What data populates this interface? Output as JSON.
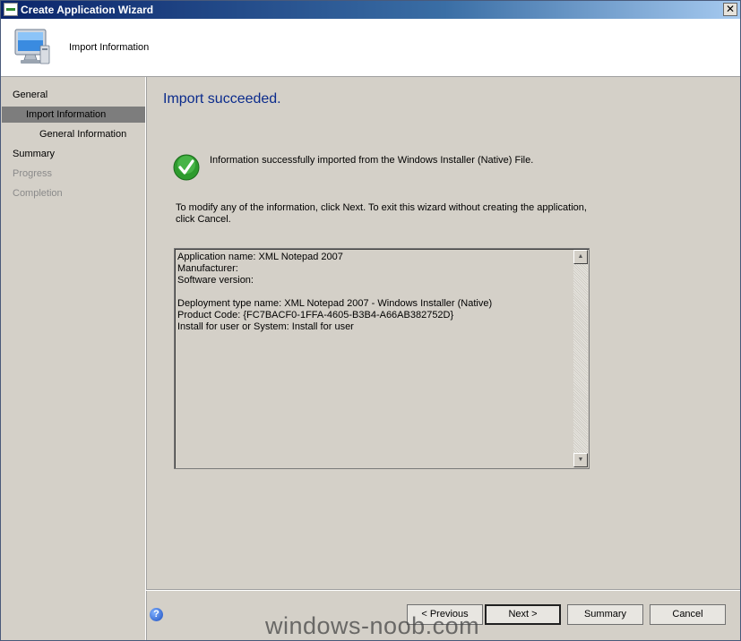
{
  "window": {
    "title": "Create Application Wizard",
    "close_glyph": "✕"
  },
  "header": {
    "title": "Import Information",
    "icon": "computer-monitor-icon"
  },
  "sidebar": {
    "items": [
      {
        "label": "General",
        "state": "normal"
      },
      {
        "label": "Import Information",
        "state": "selected"
      },
      {
        "label": "General Information",
        "state": "normal"
      },
      {
        "label": "Summary",
        "state": "normal"
      },
      {
        "label": "Progress",
        "state": "disabled"
      },
      {
        "label": "Completion",
        "state": "disabled"
      }
    ]
  },
  "content": {
    "title": "Import succeeded.",
    "success_icon": "green-checkmark-icon",
    "message": "Information successfully imported from the Windows Installer (Native) File.",
    "instruction": "To modify any of the information, click Next. To exit this wizard without creating the application, click Cancel.",
    "info_lines": [
      "Application name: XML Notepad 2007",
      "Manufacturer:",
      "Software version:",
      "",
      "Deployment type name: XML Notepad 2007 - Windows Installer (Native)",
      "Product Code: {FC7BACF0-1FFA-4605-B3B4-A66AB382752D}",
      "Install for user or System: Install for user"
    ]
  },
  "footer": {
    "help_glyph": "?",
    "previous_label": "< Previous",
    "next_label": "Next >",
    "summary_label": "Summary",
    "cancel_label": "Cancel"
  },
  "watermark": "windows-noob.com"
}
